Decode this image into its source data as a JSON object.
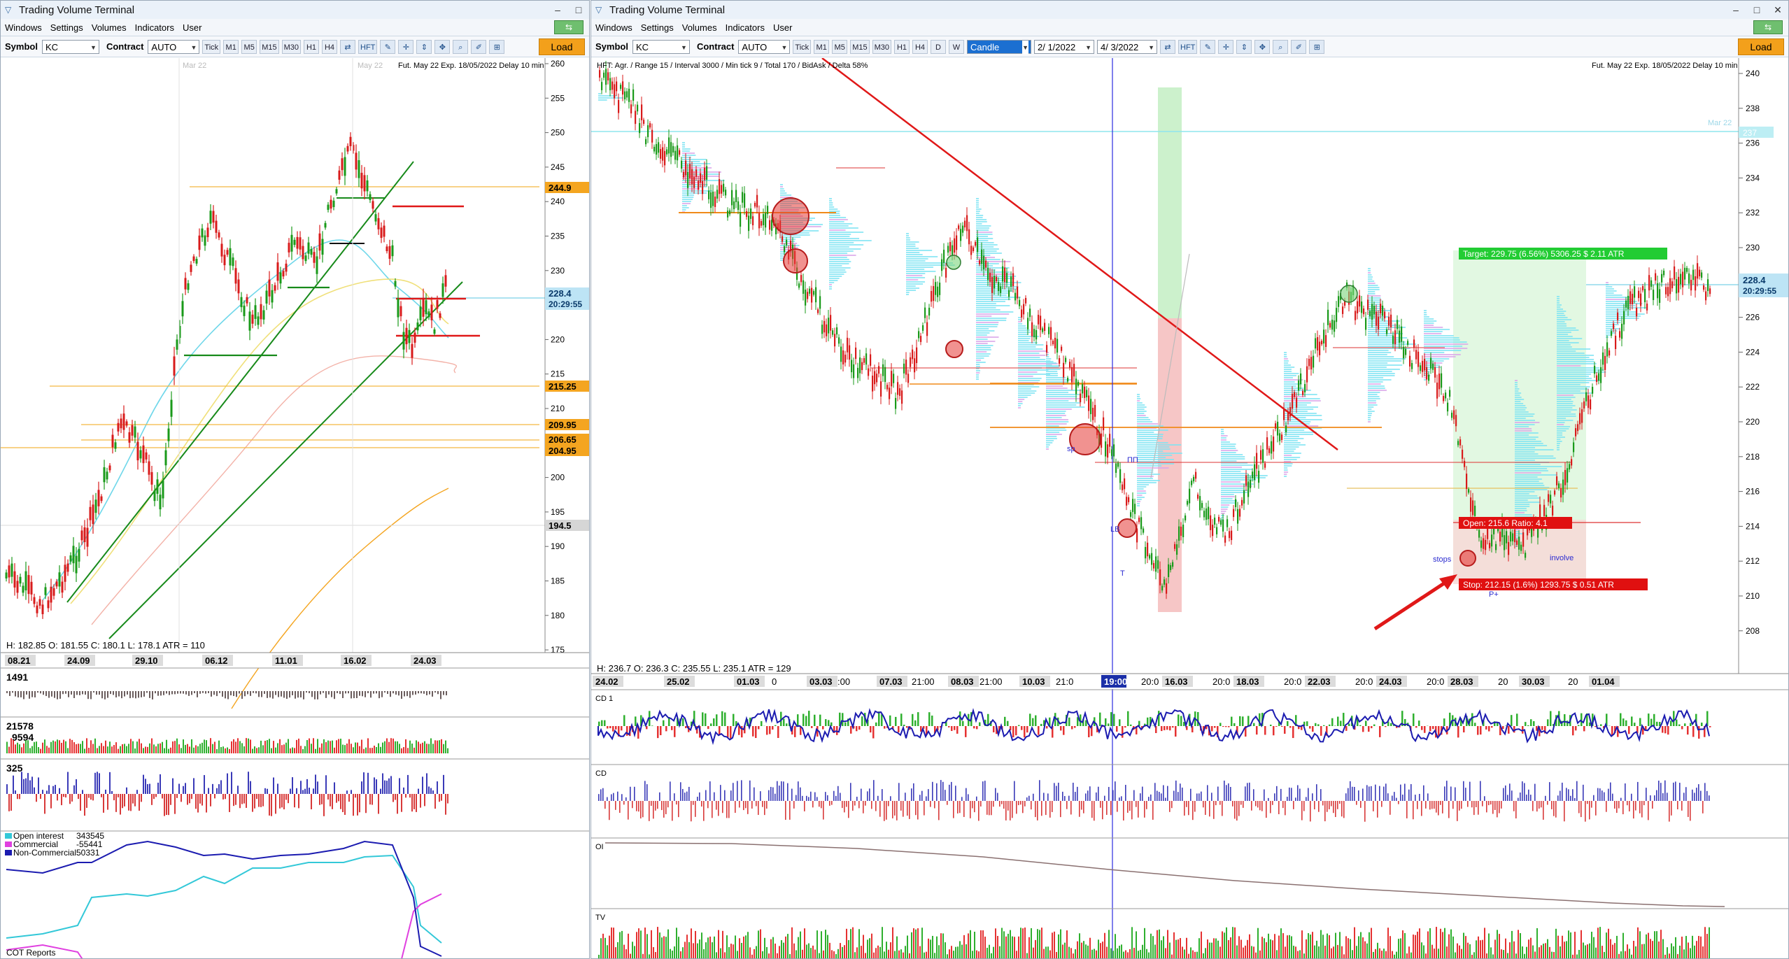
{
  "app": {
    "title": "Trading Volume Terminal"
  },
  "menu": [
    "Windows",
    "Settings",
    "Volumes",
    "Indicators",
    "User"
  ],
  "left": {
    "symbol_label": "Symbol",
    "symbol": "KC",
    "contract_label": "Contract",
    "contract": "AUTO",
    "timeframes": [
      "Tick",
      "M1",
      "M5",
      "M15",
      "M30",
      "H1",
      "H4"
    ],
    "hft": "HFT",
    "load": "Load",
    "info": "Fut. May 22 Exp. 18/05/2022 Delay 10 min",
    "month_labels": [
      "Mar 22",
      "May 22"
    ],
    "price_ticks": [
      "260",
      "255",
      "250",
      "245",
      "240",
      "235",
      "230",
      "225",
      "220",
      "215",
      "210",
      "205",
      "200",
      "195",
      "190",
      "185",
      "180",
      "175"
    ],
    "level_tags": [
      "244.9",
      "228.4",
      "20:29:55",
      "215.25",
      "209.95",
      "206.65",
      "204.95",
      "194.5"
    ],
    "ohlc": "H: 182.85  O: 181.55  C: 180.1  L: 178.1  ATR = 110",
    "dates": [
      "08.21",
      "24.09",
      "29.10",
      "06.12",
      "11.01",
      "16.02",
      "24.03"
    ],
    "panels": {
      "p1_value": "1491",
      "p2_value_a": "21578",
      "p2_value_b": "9594",
      "p3_value": "325",
      "cot_title": "COT Reports"
    },
    "cot_legend": [
      {
        "label": "Open interest",
        "value": "343545",
        "color": "#33c8d8"
      },
      {
        "label": "Commercial",
        "value": "-55441",
        "color": "#e040e0"
      },
      {
        "label": "Non-Commercial",
        "value": "50331",
        "color": "#1b1bb0"
      }
    ]
  },
  "right": {
    "symbol_label": "Symbol",
    "symbol": "KC",
    "contract_label": "Contract",
    "contract": "AUTO",
    "timeframes": [
      "Tick",
      "M1",
      "M5",
      "M15",
      "M30",
      "H1",
      "H4",
      "D",
      "W"
    ],
    "chart_type": "Candle",
    "date_from": "2/ 1/2022",
    "date_to": "4/ 3/2022",
    "hft": "HFT",
    "load": "Load",
    "header": "HFT: Agr. / Range 15 / Interval 3000 / Min tick 9 / Total 170 / BidAsk / Delta 58%",
    "info": "Fut. May 22 Exp. 18/05/2022 Delay 10 min",
    "month_label": "Mar 22",
    "price_ticks": [
      "240",
      "238",
      "236",
      "234",
      "232",
      "230",
      "228",
      "226",
      "224",
      "222",
      "220",
      "218",
      "216",
      "214",
      "212",
      "210",
      "208"
    ],
    "price_tag": "228.4",
    "time_tag": "20:29:55",
    "level_tag": "237",
    "target_label": "Target: 229.75 (6.56%) 5306.25 $ 2.11 ATR",
    "open_label": "Open: 215.6  Ratio: 4.1",
    "stop_label": "Stop: 212.15 (1.6%) 1293.75 $ 0.51 ATR",
    "annotations": {
      "stops": "stops",
      "involve": "involve",
      "pp": "P+",
      "nn": "ПП",
      "lb": "LB",
      "t": "T",
      "sp": "sp"
    },
    "ohlc": "H: 236.7  O: 236.3  C: 235.55  L: 235.1  ATR = 129",
    "dates": [
      "24.02",
      "25.02",
      "01.03",
      "03.03",
      "07.03",
      "08.03",
      "10.03",
      "16.03",
      "18.03",
      "22.03",
      "24.03",
      "28.03",
      "30.03",
      "01.04"
    ],
    "intraday": [
      "0",
      ":00",
      "21:00",
      "21:00",
      "21:0",
      "20:0",
      "20:0",
      "20:0",
      "20:0",
      "20:0",
      "20",
      "20"
    ],
    "cursor_time": "19:00",
    "panels": {
      "cd1": "CD 1",
      "cd": "CD",
      "oi": "OI",
      "tv": "TV"
    }
  }
}
